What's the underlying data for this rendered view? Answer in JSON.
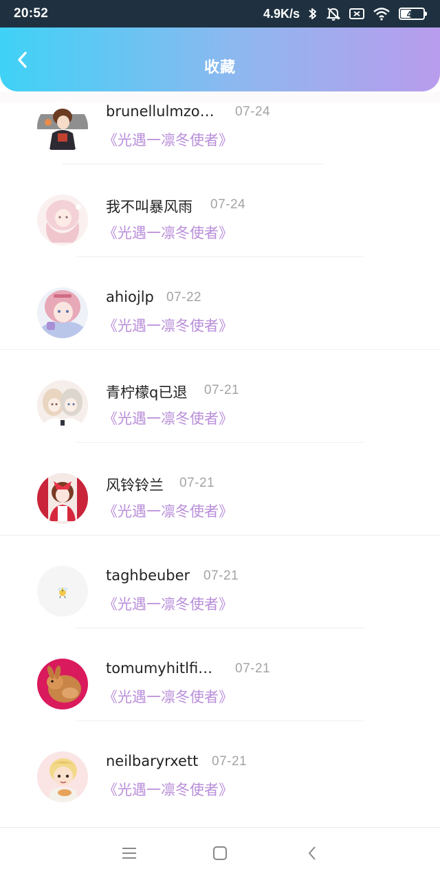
{
  "status_bar": {
    "time": "20:52",
    "net_speed": "4.9K/s",
    "battery_level": "44"
  },
  "header": {
    "title": "收藏"
  },
  "favorites": [
    {
      "name": "brunellulmzo…",
      "date": "07-24",
      "work": "《光遇一凛冬使者》"
    },
    {
      "name": "我不叫暴风雨",
      "date": "07-24",
      "work": "《光遇一凛冬使者》"
    },
    {
      "name": "ahiojlp",
      "date": "07-22",
      "work": "《光遇一凛冬使者》"
    },
    {
      "name": "青柠檬q已退",
      "date": "07-21",
      "work": "《光遇一凛冬使者》"
    },
    {
      "name": "风铃铃兰",
      "date": "07-21",
      "work": "《光遇一凛冬使者》"
    },
    {
      "name": "taghbeuber",
      "date": "07-21",
      "work": "《光遇一凛冬使者》"
    },
    {
      "name": "tomumyhitlfi…",
      "date": "07-21",
      "work": "《光遇一凛冬使者》"
    },
    {
      "name": "neilbaryrxett",
      "date": "07-21",
      "work": "《光遇一凛冬使者》"
    }
  ],
  "colors": {
    "header_gradient_start": "#3fd2f6",
    "header_gradient_end": "#b99ced",
    "work_title": "#b98ed9",
    "date_text": "#a3a3a3"
  },
  "icons": {
    "back": "chevron-left-icon",
    "nav_menu": "menu-icon",
    "nav_home": "home-square-icon",
    "nav_back": "back-triangle-icon"
  }
}
